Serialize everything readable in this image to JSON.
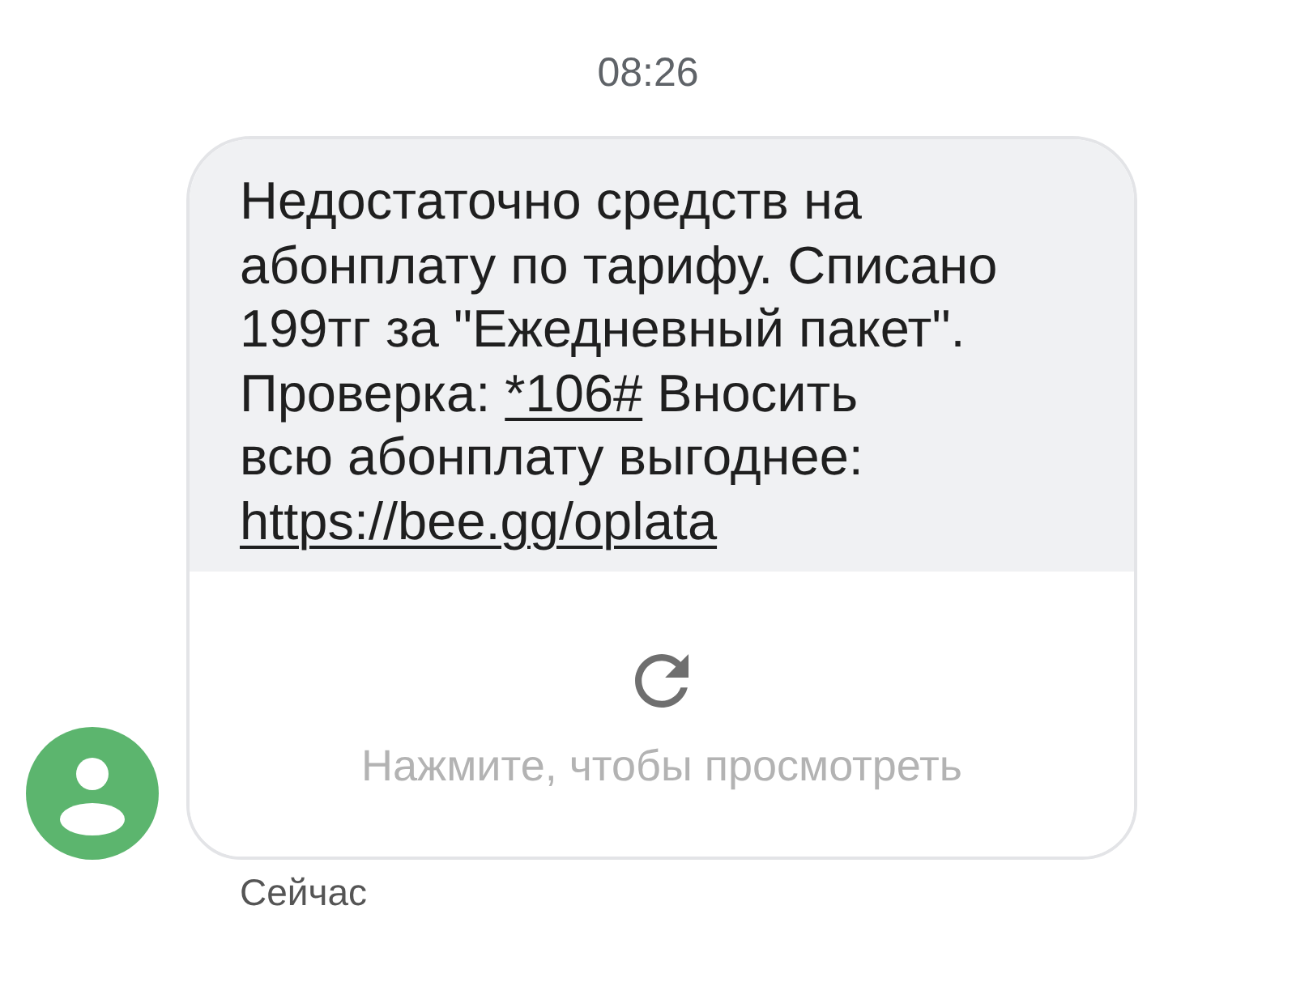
{
  "header": {
    "time": "08:26"
  },
  "message": {
    "parts": [
      {
        "kind": "text",
        "text": "Недостаточно средств на абонплату по тарифу. Списано 199тг за \"Ежедневный пакет\". Проверка:"
      },
      {
        "kind": "link",
        "text": "*106#"
      },
      {
        "kind": "text",
        "text": "Вносить\nвсю абонплату выгоднее:"
      },
      {
        "kind": "link",
        "text": "https://bee.gg/oplata"
      }
    ]
  },
  "preview": {
    "label": "Нажмите, чтобы просмотреть"
  },
  "footer": {
    "status": "Сейчас"
  }
}
